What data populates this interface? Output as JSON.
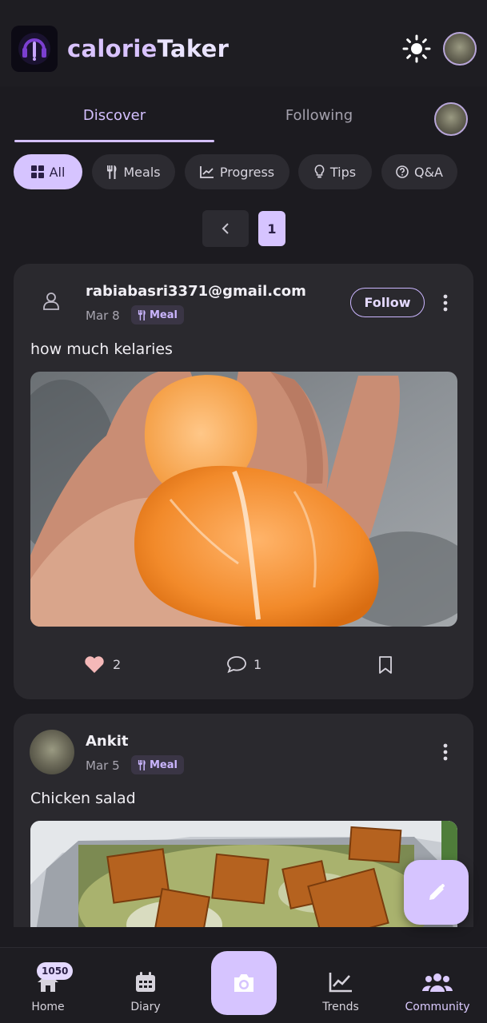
{
  "app": {
    "brand_part1": "calorie",
    "brand_part2": "Taker",
    "logo_icon": "app-logo-icon",
    "theme_icon": "sun-icon"
  },
  "tabs": [
    {
      "label": "Discover",
      "active": true
    },
    {
      "label": "Following",
      "active": false
    }
  ],
  "filters": [
    {
      "label": "All",
      "icon": "grid-icon",
      "active": true
    },
    {
      "label": "Meals",
      "icon": "utensils-icon",
      "active": false
    },
    {
      "label": "Progress",
      "icon": "chart-icon",
      "active": false
    },
    {
      "label": "Tips",
      "icon": "lightbulb-icon",
      "active": false
    },
    {
      "label": "Q&A",
      "icon": "question-icon",
      "active": false
    }
  ],
  "pagination": {
    "current_page": "1"
  },
  "posts": [
    {
      "author": "rabiabasri3371@gmail.com",
      "date": "Mar 8",
      "category": "Meal",
      "follow_label": "Follow",
      "text": "how much kelaries",
      "likes": "2",
      "comments": "1",
      "liked": true
    },
    {
      "author": "Ankit",
      "date": "Mar 5",
      "category": "Meal",
      "text": "Chicken salad"
    }
  ],
  "bottom_nav": {
    "home_label": "Home",
    "home_badge": "1050",
    "diary_label": "Diary",
    "trends_label": "Trends",
    "community_label": "Community",
    "active": "Community"
  },
  "colors": {
    "background": "#1c1b20",
    "card": "#2a292e",
    "accent": "#d6c4ff",
    "like": "#f4b8b8"
  }
}
